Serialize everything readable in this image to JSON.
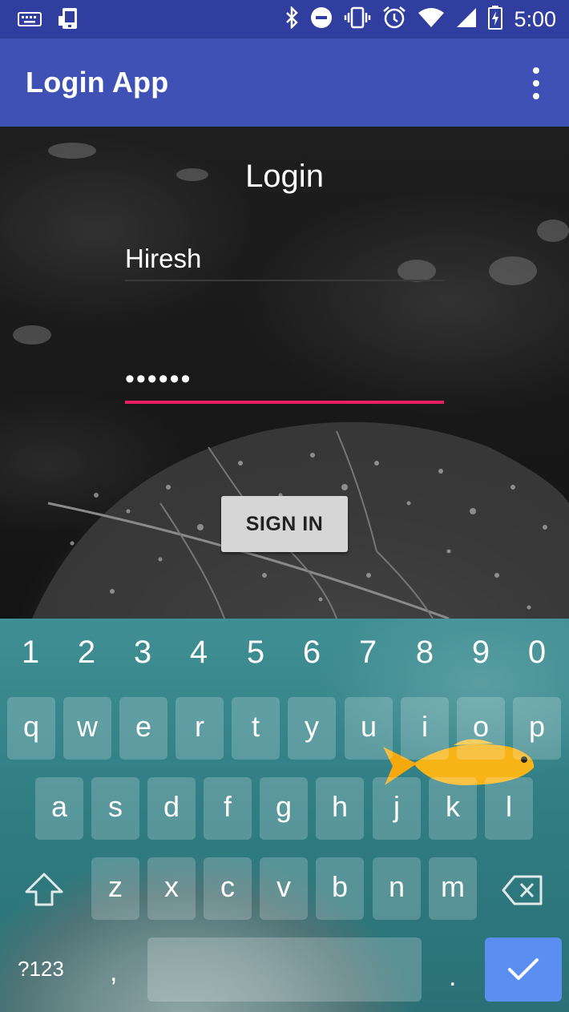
{
  "status_bar": {
    "time": "5:00",
    "left_icons": [
      "keyboard-icon",
      "screen-cast-icon"
    ],
    "right_icons": [
      "bluetooth-icon",
      "do-not-disturb-icon",
      "vibrate-icon",
      "alarm-icon",
      "wifi-icon",
      "cellular-signal-icon",
      "battery-charging-icon"
    ]
  },
  "app_bar": {
    "title": "Login App",
    "overflow_icon": "more-vert-icon"
  },
  "login": {
    "title": "Login",
    "username_value": "Hiresh",
    "password_value": "••••••",
    "signin_label": "SIGN IN",
    "accent_color": "#e91e63"
  },
  "keyboard": {
    "number_row": [
      "1",
      "2",
      "3",
      "4",
      "5",
      "6",
      "7",
      "8",
      "9",
      "0"
    ],
    "row1": [
      "q",
      "w",
      "e",
      "r",
      "t",
      "y",
      "u",
      "i",
      "o",
      "p"
    ],
    "row2": [
      "a",
      "s",
      "d",
      "f",
      "g",
      "h",
      "j",
      "k",
      "l"
    ],
    "row3": [
      "z",
      "x",
      "c",
      "v",
      "b",
      "n",
      "m"
    ],
    "symbols_label": "?123",
    "comma_label": ",",
    "period_label": ".",
    "shift_icon": "shift-icon",
    "backspace_icon": "backspace-icon",
    "enter_icon": "checkmark-icon",
    "enter_color": "#5a8ef0"
  },
  "colors": {
    "status_bar": "#303f9f",
    "app_bar": "#3f51b5"
  }
}
